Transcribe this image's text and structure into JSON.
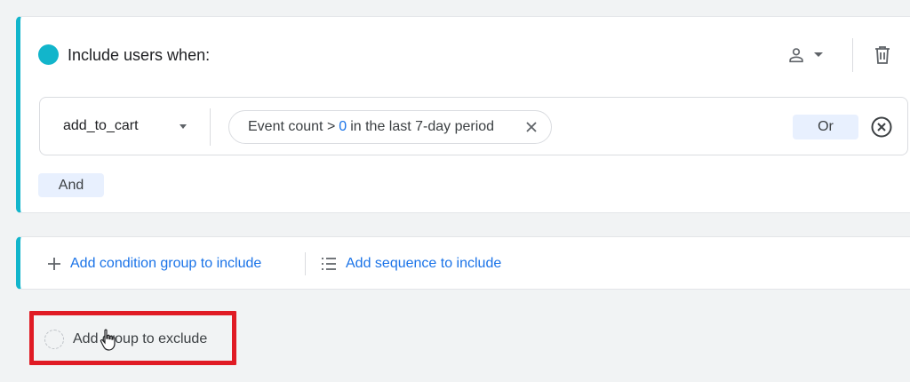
{
  "include_group": {
    "title": "Include users when:",
    "icons": {
      "scope": "person-icon",
      "scope_menu": "caret-down-icon",
      "delete": "trash-icon"
    },
    "condition": {
      "event_name": "add_to_cart",
      "chip_prefix": "Event count >",
      "chip_value": "0",
      "chip_suffix": "in the last 7-day period",
      "or_label": "Or"
    },
    "and_label": "And"
  },
  "add_actions": {
    "condition_group": "Add condition group to include",
    "sequence": "Add sequence to include"
  },
  "exclude": {
    "label": "Add group to exclude"
  },
  "colors": {
    "accent_teal": "#12b5cb",
    "link_blue": "#1a73e8",
    "chip_bg": "#e8f0fe",
    "highlight_red": "#e01b24",
    "page_bg": "#f1f3f4"
  }
}
